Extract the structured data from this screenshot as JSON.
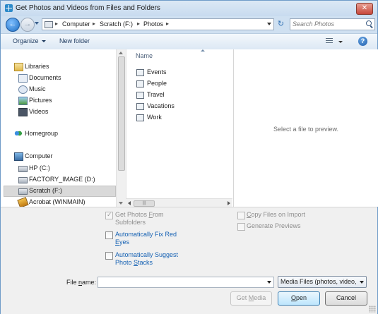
{
  "window": {
    "title": "Get Photos and Videos from Files and Folders",
    "close_label": "✕"
  },
  "address": {
    "crumbs": [
      "Computer",
      "Scratch (F:)",
      "Photos"
    ],
    "back_glyph": "←",
    "forward_glyph": "→",
    "refresh_glyph": "↻",
    "search_placeholder": "Search Photos"
  },
  "toolbar": {
    "organize_label": "Organize",
    "new_folder_label": "New folder",
    "help_glyph": "?"
  },
  "nav": {
    "items": [
      {
        "label": "Libraries",
        "icon": "library-icon"
      },
      {
        "label": "Documents",
        "icon": "documents-icon"
      },
      {
        "label": "Music",
        "icon": "music-icon"
      },
      {
        "label": "Pictures",
        "icon": "pictures-icon"
      },
      {
        "label": "Videos",
        "icon": "videos-icon"
      },
      {
        "label": "Homegroup",
        "icon": "homegroup-icon"
      },
      {
        "label": "Computer",
        "icon": "computer-icon"
      },
      {
        "label": "HP (C:)",
        "icon": "drive-icon"
      },
      {
        "label": "FACTORY_IMAGE (D:)",
        "icon": "drive-icon"
      },
      {
        "label": "Scratch (F:)",
        "icon": "drive-icon",
        "selected": true
      },
      {
        "label": "Acrobat (WINMAIN)",
        "icon": "acrobat-icon"
      }
    ]
  },
  "filelist": {
    "column_name": "Name",
    "items": [
      "Events",
      "People",
      "Travel",
      "Vacations",
      "Work"
    ],
    "scroll_thumb_glyph": "|||"
  },
  "preview": {
    "message": "Select a file to preview."
  },
  "options": {
    "get_from_subfolders": {
      "label_line1": "Get Photos ",
      "label_u": "F",
      "label_rest1": "rom",
      "label_line2": "Subfolders",
      "checked": true,
      "enabled": false
    },
    "auto_fix_red_eyes": {
      "label_line1": "Automatically Fix Red",
      "label_u": "E",
      "label_rest2": "yes",
      "checked": false
    },
    "auto_suggest_stacks": {
      "label_line1": "Automatically Suggest",
      "label_line2_pre": "Photo ",
      "label_u": "S",
      "label_rest2": "tacks",
      "checked": false
    },
    "copy_files_on_import": {
      "label_u": "C",
      "label_rest": "opy Files on Import",
      "checked": false,
      "enabled": false
    },
    "generate_previews": {
      "label": "Generate Previews",
      "checked": false,
      "enabled": false
    }
  },
  "file_name": {
    "label_pre": "File ",
    "label_u": "n",
    "label_post": "ame:",
    "value": ""
  },
  "file_type": {
    "selected": "Media Files (photos, video, a"
  },
  "buttons": {
    "get_media_pre": "Get ",
    "get_media_u": "M",
    "get_media_post": "edia",
    "open_u": "O",
    "open_post": "pen",
    "cancel": "Cancel"
  },
  "colors": {
    "link_blue": "#1561b3",
    "primary_button_border": "#3c7fb1",
    "titlebar": "#dbe8f5"
  }
}
